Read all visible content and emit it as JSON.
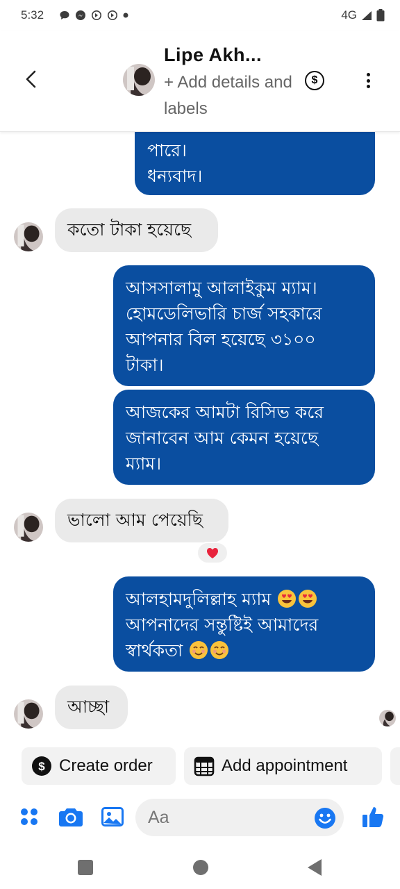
{
  "status_bar": {
    "time": "5:32",
    "network": "4G",
    "icons": [
      "chat-bubble-icon",
      "messenger-icon",
      "data-saver-icon",
      "data-saver-icon",
      "dot-icon"
    ]
  },
  "header": {
    "name": "Lipe Akh...",
    "add_details": "+ Add details and labels",
    "dollar_symbol": "$"
  },
  "messages": [
    {
      "direction": "out",
      "lines": [
        "পারে।",
        "ধন্যবাদ।"
      ]
    },
    {
      "direction": "in",
      "text": "কতো টাকা হয়েছে"
    },
    {
      "direction": "out",
      "lines": [
        "আসসালামু আলাইকুম ম্যাম।",
        "হোমডেলিভারি চার্জ সহকারে",
        "আপনার বিল হয়েছে ৩১০০",
        "টাকা।"
      ]
    },
    {
      "direction": "out",
      "lines": [
        "আজকের আমটা রিসিভ করে",
        "জানাবেন আম কেমন হয়েছে",
        "ম্যাম।"
      ]
    },
    {
      "direction": "in",
      "text": "ভালো আম পেয়েছি",
      "reaction": "heart"
    },
    {
      "direction": "out",
      "lines": [
        "আলহামদুলিল্লাহ ম্যাম",
        "আপনাদের সন্তুষ্টিই আমাদের",
        "স্বার্থকতা"
      ]
    },
    {
      "direction": "in",
      "text": "আচ্ছা"
    }
  ],
  "quick_actions": {
    "create_order": "Create order",
    "add_appointment": "Add appointment"
  },
  "composer": {
    "placeholder": "Aa"
  },
  "colors": {
    "outgoing_bubble": "#0a4ea0",
    "incoming_bubble": "#eaeaea",
    "accent": "#1877f2"
  }
}
